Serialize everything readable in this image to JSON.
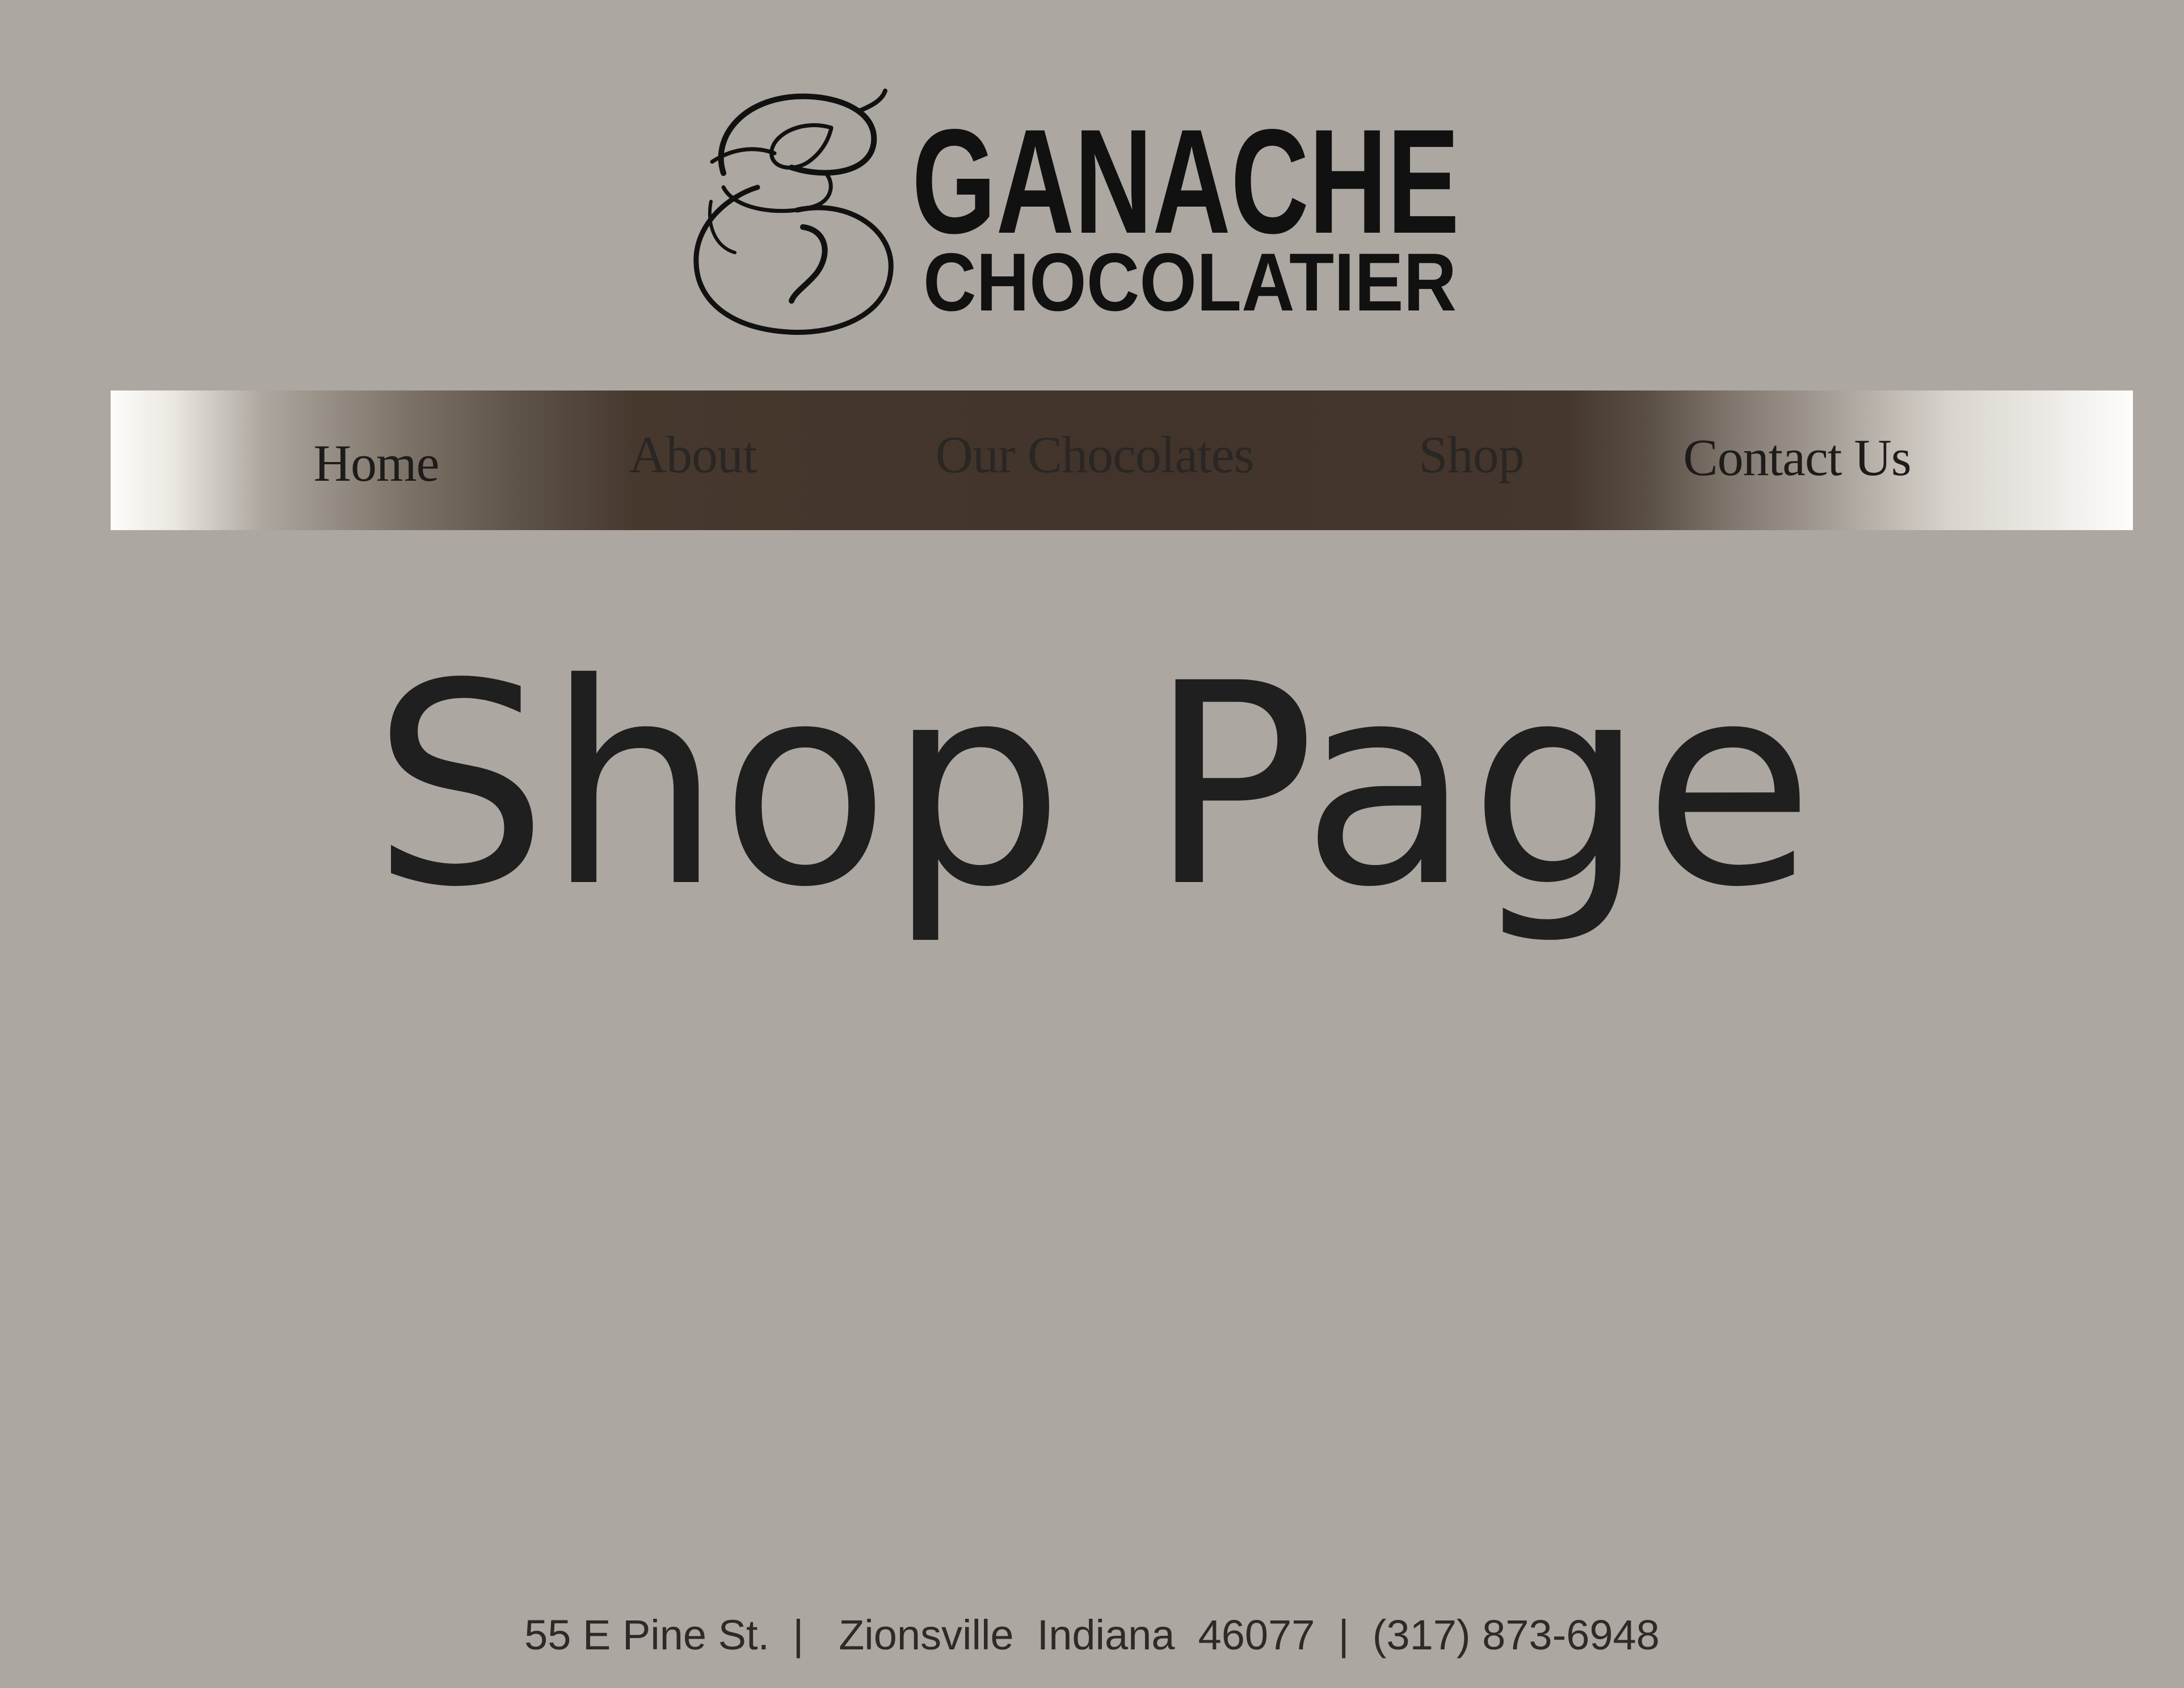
{
  "brand": {
    "name_line1": "GANACHE",
    "name_line2": "CHOCOLATIER",
    "logo_emblem_icon": "script-g-monogram-icon"
  },
  "nav": {
    "items": [
      {
        "label": "Home"
      },
      {
        "label": "About"
      },
      {
        "label": "Our Chocolates"
      },
      {
        "label": "Shop"
      },
      {
        "label": "Contact Us"
      }
    ]
  },
  "main": {
    "title": "Shop Page"
  },
  "footer": {
    "address": "55 E Pine St.  |   Zionsville  Indiana  46077  |  (317) 873-6948"
  },
  "colors": {
    "background": "#ada7a1",
    "nav_dark": "#42342b",
    "nav_light": "#fefdfb",
    "text": "#1f1f1f"
  }
}
